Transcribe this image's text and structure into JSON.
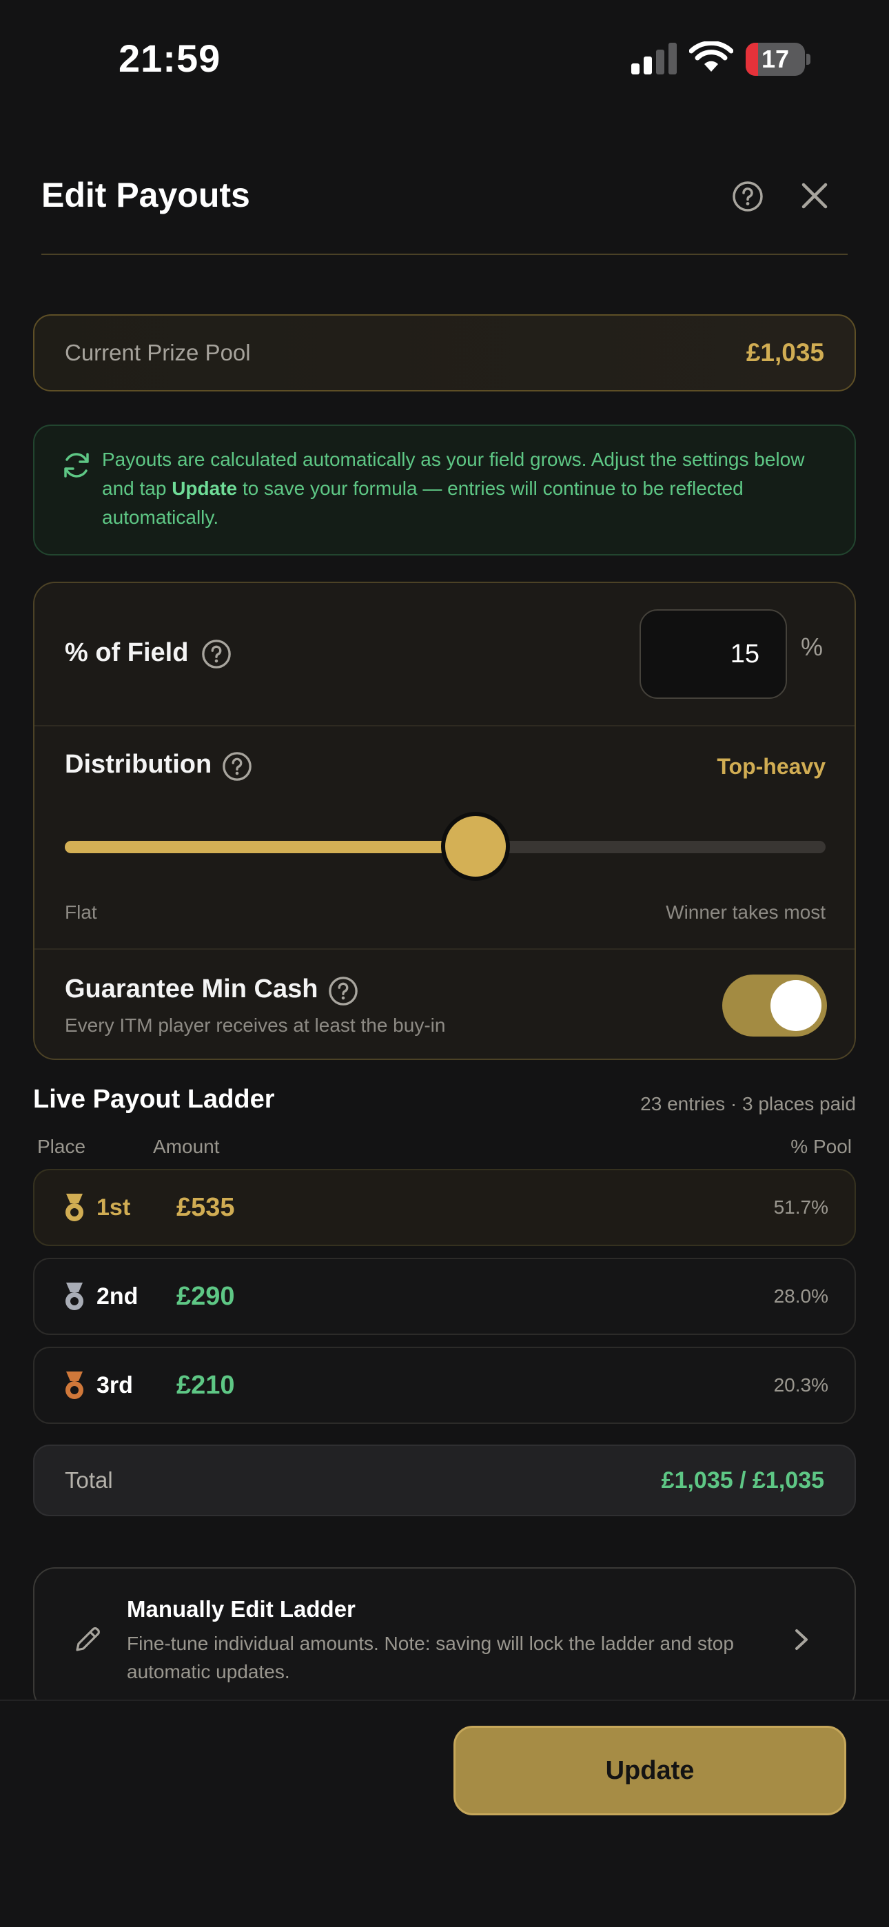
{
  "status_bar": {
    "time": "21:59",
    "battery": "17"
  },
  "header": {
    "title": "Edit Payouts"
  },
  "prize_pool": {
    "label": "Current Prize Pool",
    "value": "£1,035"
  },
  "info": {
    "text_before": "Payouts are calculated automatically as your field grows. Adjust the settings below and tap ",
    "highlight": "Update",
    "text_after": " to save your formula — entries will continue to be reflected automatically."
  },
  "settings": {
    "field": {
      "label": "% of Field",
      "value": "15",
      "unit": "%"
    },
    "distribution": {
      "label": "Distribution",
      "value": "Top-heavy",
      "level": 0.54,
      "min_label": "Flat",
      "max_label": "Winner takes most"
    },
    "guarantee": {
      "label": "Guarantee Min Cash",
      "sub": "Every ITM player receives at least the buy-in",
      "on": true
    }
  },
  "ladder": {
    "title": "Live Payout Ladder",
    "meta": "23 entries · 3 places paid",
    "columns": {
      "place": "Place",
      "amount": "Amount",
      "pct": "% Pool"
    },
    "rows": [
      {
        "place": "1st",
        "amount": "£535",
        "pct": "51.7%",
        "medal_color": "#d1ad53"
      },
      {
        "place": "2nd",
        "amount": "£290",
        "pct": "28.0%",
        "medal_color": "#a9adb6"
      },
      {
        "place": "3rd",
        "amount": "£210",
        "pct": "20.3%",
        "medal_color": "#d0783a"
      }
    ],
    "total": {
      "label": "Total",
      "value": "£1,035 / £1,035"
    }
  },
  "manual": {
    "title": "Manually Edit Ladder",
    "sub": "Fine-tune individual amounts. Note: saving will lock the ladder and stop automatic updates."
  },
  "footer": {
    "update_label": "Update"
  },
  "colors": {
    "gold": "#d1ad53",
    "green": "#5ec785",
    "background": "#131314"
  }
}
